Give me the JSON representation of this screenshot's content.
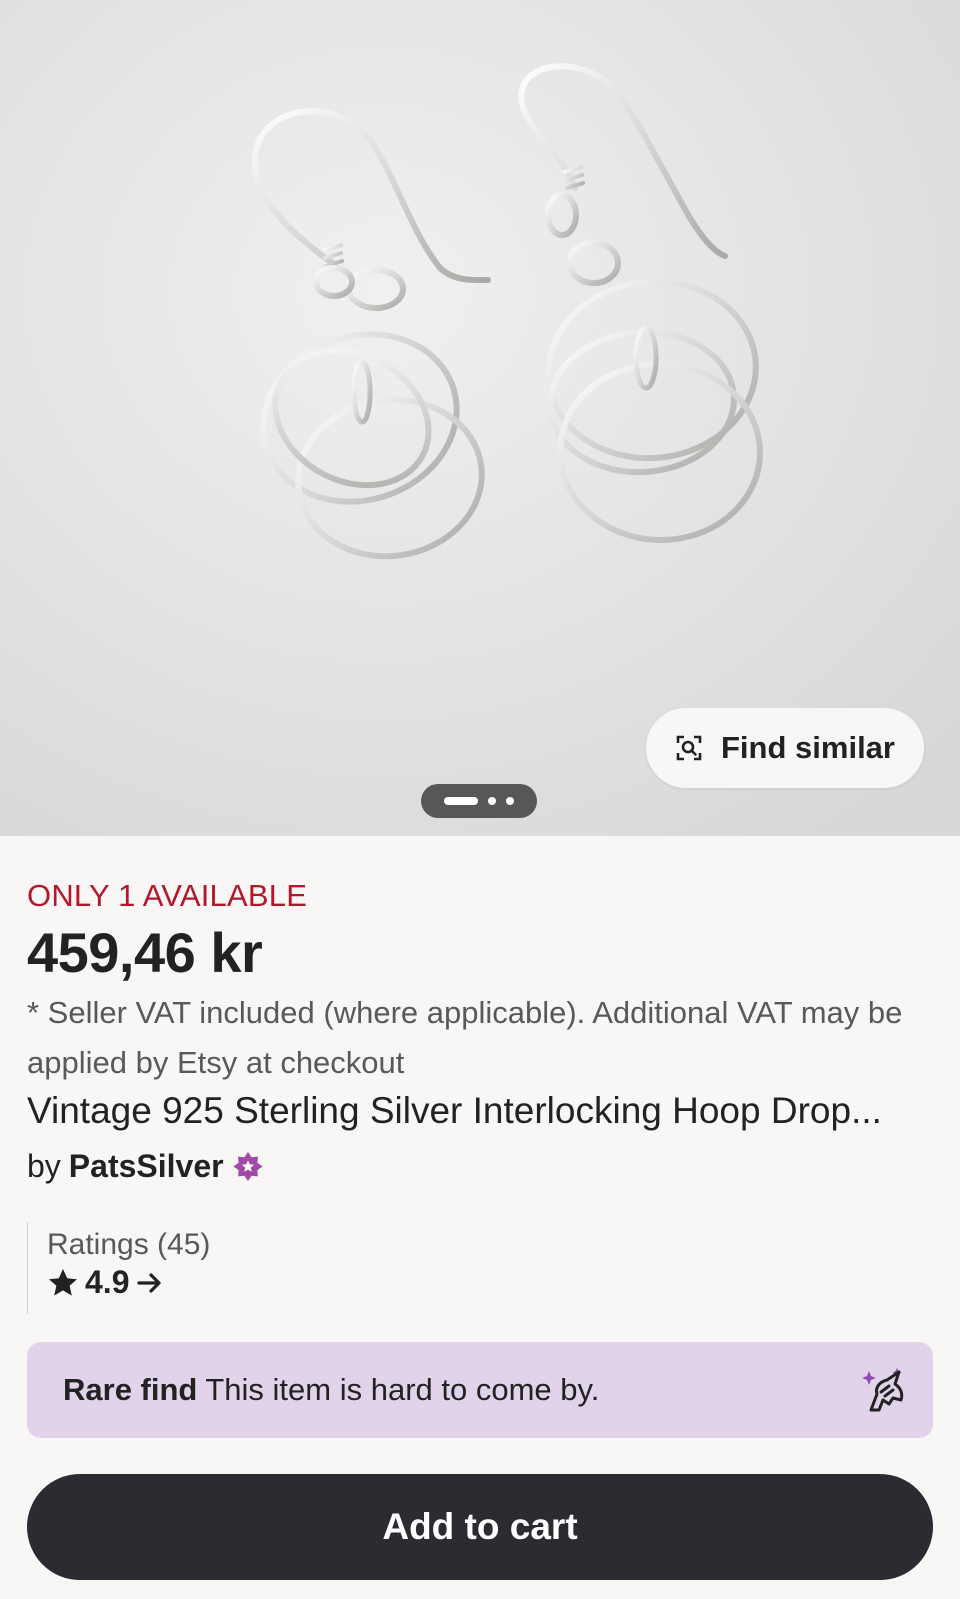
{
  "hero": {
    "image_alt": "Silver interlocking hoop drop earrings",
    "find_similar_label": "Find similar",
    "find_similar_icon": "visual-search-icon",
    "pager_icon": "carousel-pager"
  },
  "listing": {
    "availability": "ONLY 1 AVAILABLE",
    "price": "459,46 kr",
    "vat_note": "* Seller VAT included (where applicable). Additional VAT may be applied by Etsy at checkout",
    "title": "Vintage 925 Sterling Silver Interlocking Hoop Drop...",
    "by": "by",
    "shop_name": "PatsSilver",
    "shop_badge_icon": "star-seller-icon"
  },
  "ratings": {
    "label": "Ratings (45)",
    "score": "4.9",
    "star_icon": "star-icon",
    "arrow_icon": "arrow-right-icon"
  },
  "rare_find": {
    "bold": "Rare find",
    "text": "This item is hard to come by.",
    "icon": "unicorn-icon"
  },
  "cart": {
    "label": "Add to cart"
  },
  "colors": {
    "availability_red": "#b3172c",
    "star_seller_purple": "#a24aa8",
    "rare_bg": "#e1d3ea",
    "cart_bg": "#2e2a31",
    "page_bg": "#f8f7f5"
  }
}
